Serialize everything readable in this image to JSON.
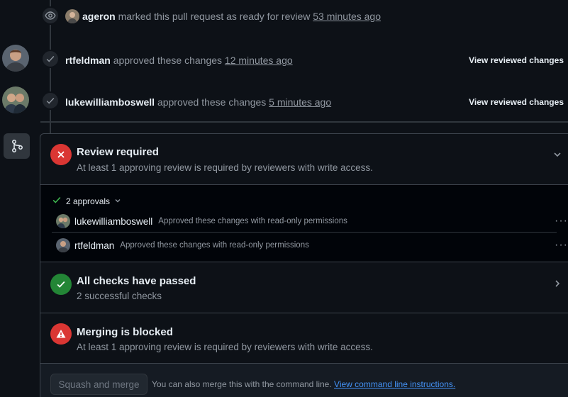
{
  "timeline": {
    "ready_event": {
      "author": "ageron",
      "action": "marked this pull request as ready for review",
      "time": "53 minutes ago"
    },
    "approvals": [
      {
        "author": "rtfeldman",
        "action": "approved these changes",
        "time": "12 minutes ago",
        "link": "View reviewed changes"
      },
      {
        "author": "lukewilliamboswell",
        "action": "approved these changes",
        "time": "5 minutes ago",
        "link": "View reviewed changes"
      }
    ]
  },
  "merge_box": {
    "review": {
      "title": "Review required",
      "subtitle": "At least 1 approving review is required by reviewers with write access.",
      "approvals_label": "2 approvals",
      "reviewers": [
        {
          "name": "lukewilliamboswell",
          "note": "Approved these changes with read-only permissions",
          "menu": "···"
        },
        {
          "name": "rtfeldman",
          "note": "Approved these changes with read-only permissions",
          "menu": "···"
        }
      ]
    },
    "checks": {
      "title": "All checks have passed",
      "subtitle": "2 successful checks"
    },
    "blocked": {
      "title": "Merging is blocked",
      "subtitle": "At least 1 approving review is required by reviewers with write access."
    },
    "footer": {
      "button_label": "Squash and merge",
      "text": "You can also merge this with the command line.",
      "link": "View command line instructions."
    }
  },
  "colors": {
    "background": "#0d1117",
    "danger": "#da3633",
    "success": "#238636",
    "link": "#4493f8",
    "muted": "#9198a1"
  }
}
